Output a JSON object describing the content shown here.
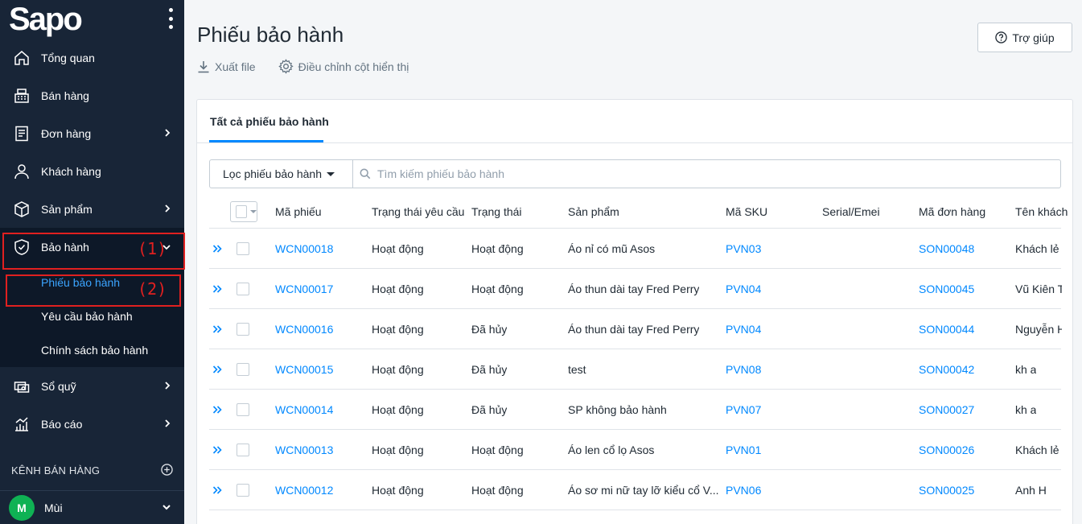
{
  "brand": {
    "logo_text": "Sapo"
  },
  "sidebar": {
    "items": [
      {
        "label": "Tổng quan",
        "icon": "home-icon",
        "has_chevron": false
      },
      {
        "label": "Bán hàng",
        "icon": "cash-register-icon",
        "has_chevron": false
      },
      {
        "label": "Đơn hàng",
        "icon": "order-icon",
        "has_chevron": true
      },
      {
        "label": "Khách hàng",
        "icon": "user-icon",
        "has_chevron": false
      },
      {
        "label": "Sản phẩm",
        "icon": "box-icon",
        "has_chevron": true
      },
      {
        "label": "Bảo hành",
        "icon": "shield-check-icon",
        "has_chevron": true,
        "expanded": true
      }
    ],
    "warranty_sub": [
      {
        "label": "Phiếu bảo hành",
        "active": true
      },
      {
        "label": "Yêu cầu bảo hành",
        "active": false
      },
      {
        "label": "Chính sách bảo hành",
        "active": false
      }
    ],
    "items_after": [
      {
        "label": "Sổ quỹ",
        "icon": "cashbook-icon",
        "has_chevron": true
      },
      {
        "label": "Báo cáo",
        "icon": "report-icon",
        "has_chevron": true
      }
    ],
    "channel_label": "KÊNH BÁN HÀNG",
    "user": {
      "initial": "M",
      "name": "Mùi"
    },
    "annotations": {
      "label_1": "(1)",
      "label_2": "(2)"
    }
  },
  "header": {
    "title": "Phiếu bảo hành",
    "help_label": "Trợ giúp",
    "export_label": "Xuất file",
    "columns_label": "Điều chỉnh cột hiển thị"
  },
  "tabs": {
    "active_label": "Tất cả phiếu bảo hành"
  },
  "filter": {
    "dropdown_label": "Lọc phiếu bảo hành",
    "search_placeholder": "Tìm kiếm phiếu bảo hành"
  },
  "table": {
    "headers": [
      "Mã phiếu",
      "Trạng thái yêu cầu",
      "Trạng thái",
      "Sản phẩm",
      "Mã SKU",
      "Serial/Emei",
      "Mã đơn hàng",
      "Tên khách"
    ],
    "rows": [
      [
        "WCN00018",
        "Hoạt động",
        "Hoạt động",
        "Áo nỉ có mũ Asos",
        "PVN03",
        "",
        "SON00048",
        "Khách lẻ"
      ],
      [
        "WCN00017",
        "Hoạt động",
        "Hoạt động",
        "Áo thun dài tay Fred Perry",
        "PVN04",
        "",
        "SON00045",
        "Vũ Kiên Tr"
      ],
      [
        "WCN00016",
        "Hoạt động",
        "Đã hủy",
        "Áo thun dài tay Fred Perry",
        "PVN04",
        "",
        "SON00044",
        "Nguyễn H"
      ],
      [
        "WCN00015",
        "Hoạt động",
        "Đã hủy",
        "test",
        "PVN08",
        "",
        "SON00042",
        "kh a"
      ],
      [
        "WCN00014",
        "Hoạt động",
        "Đã hủy",
        "SP không bảo hành",
        "PVN07",
        "",
        "SON00027",
        "kh a"
      ],
      [
        "WCN00013",
        "Hoạt động",
        "Hoạt động",
        "Áo len cổ lọ Asos",
        "PVN01",
        "",
        "SON00026",
        "Khách lẻ"
      ],
      [
        "WCN00012",
        "Hoạt động",
        "Hoạt động",
        "Áo sơ mi nữ tay lỡ kiểu cổ V...",
        "PVN06",
        "",
        "SON00025",
        "Anh H"
      ]
    ]
  },
  "colors": {
    "sidebar_bg": "#182537",
    "accent": "#0088ff",
    "annotation_red": "#e02020",
    "avatar_green": "#0fb254"
  }
}
